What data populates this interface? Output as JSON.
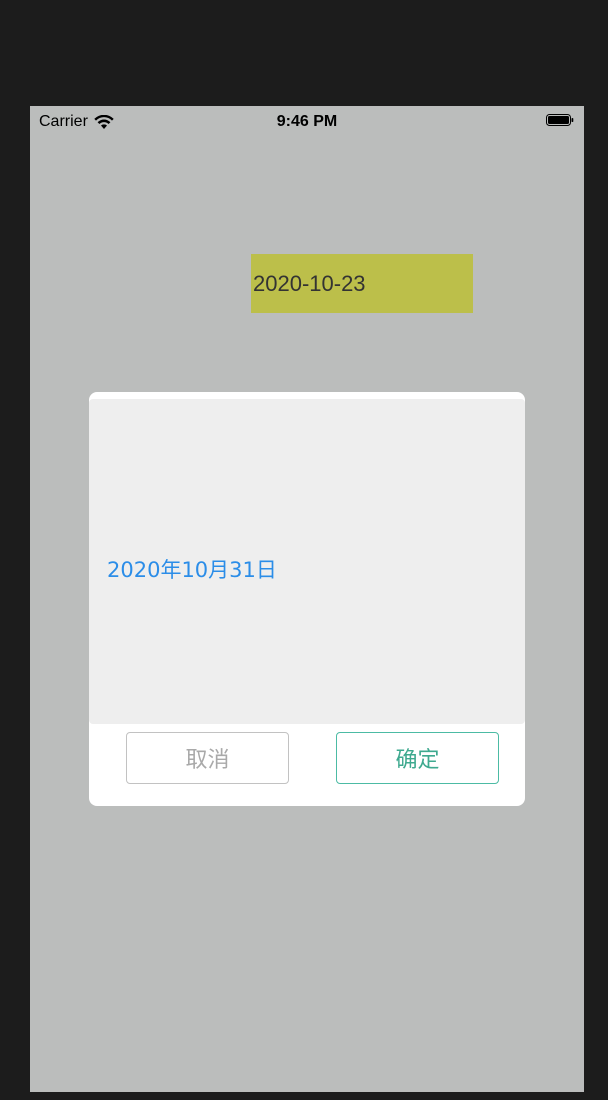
{
  "status_bar": {
    "carrier": "Carrier",
    "time": "9:46 PM",
    "wifi_icon": "wifi-icon",
    "battery_icon": "battery-icon"
  },
  "main": {
    "date_label": "2020-10-23",
    "date_label_bg": "#bcbf4a"
  },
  "dialog": {
    "picker_value": "2020年10月31日",
    "cancel_label": "取消",
    "confirm_label": "确定",
    "accent_color": "#3ea98f",
    "picker_text_color": "#2b8de8"
  }
}
